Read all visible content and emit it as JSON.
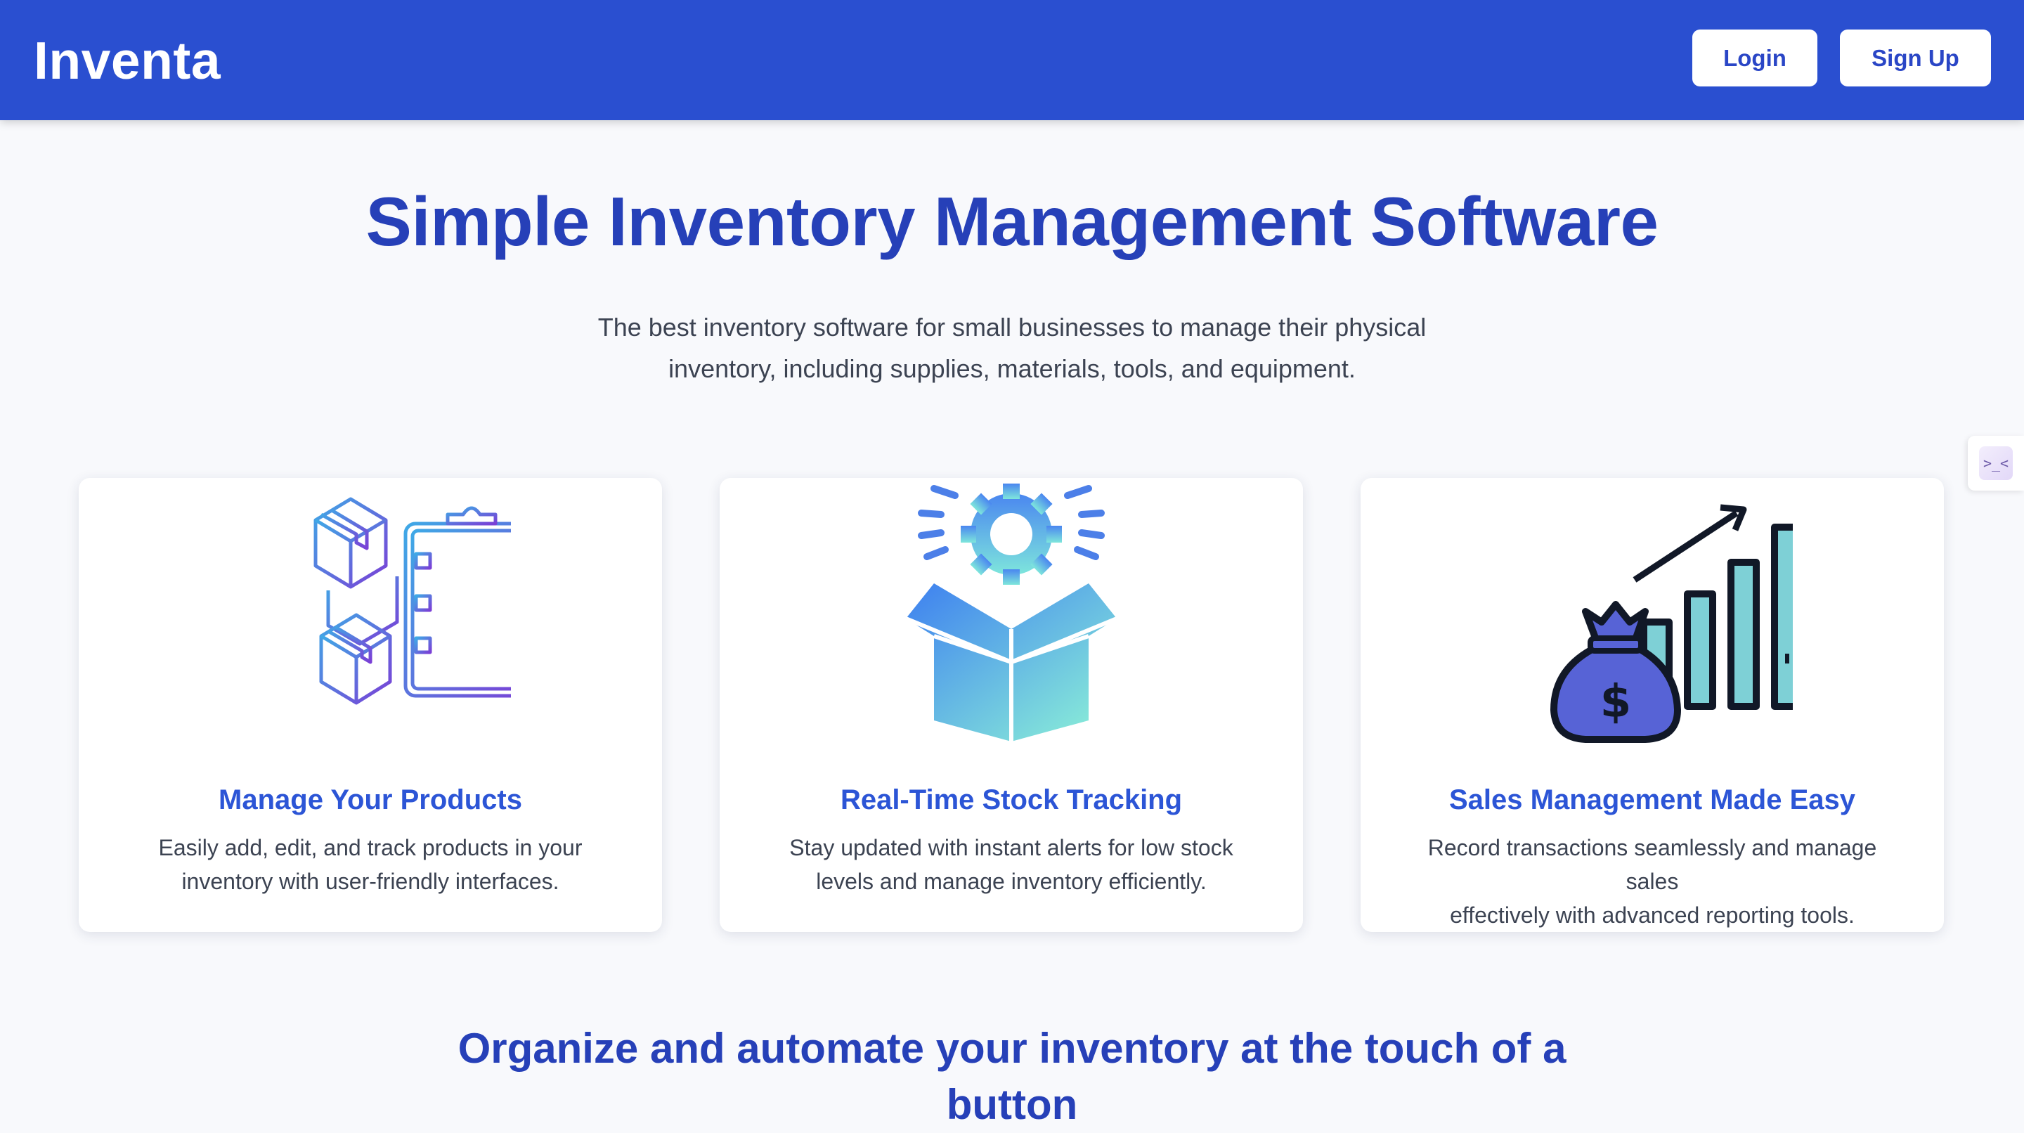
{
  "header": {
    "brand": "Inventa",
    "login_label": "Login",
    "signup_label": "Sign Up",
    "background": "#2a4fd0"
  },
  "hero": {
    "title": "Simple Inventory Management Software",
    "subtitle_line1": "The best inventory software for small businesses to manage their physical",
    "subtitle_line2": "inventory, including supplies, materials, tools, and equipment."
  },
  "features": [
    {
      "icon": "boxes-clipboard-icon",
      "title": "Manage Your Products",
      "line1": "Easily add, edit, and track products in your",
      "line2": "inventory with user-friendly interfaces."
    },
    {
      "icon": "box-gear-icon",
      "title": "Real-Time Stock Tracking",
      "line1": "Stay updated with instant alerts for low stock",
      "line2": "levels and manage inventory efficiently."
    },
    {
      "icon": "money-bag-chart-icon",
      "title": "Sales Management Made Easy",
      "line1": "Record transactions seamlessly and manage sales",
      "line2": "effectively with advanced reporting tools."
    }
  ],
  "section2": {
    "heading": "Organize and automate your inventory at the touch of a button"
  },
  "widget": {
    "icon": "extension-widget-icon",
    "glyph": ">_<"
  }
}
